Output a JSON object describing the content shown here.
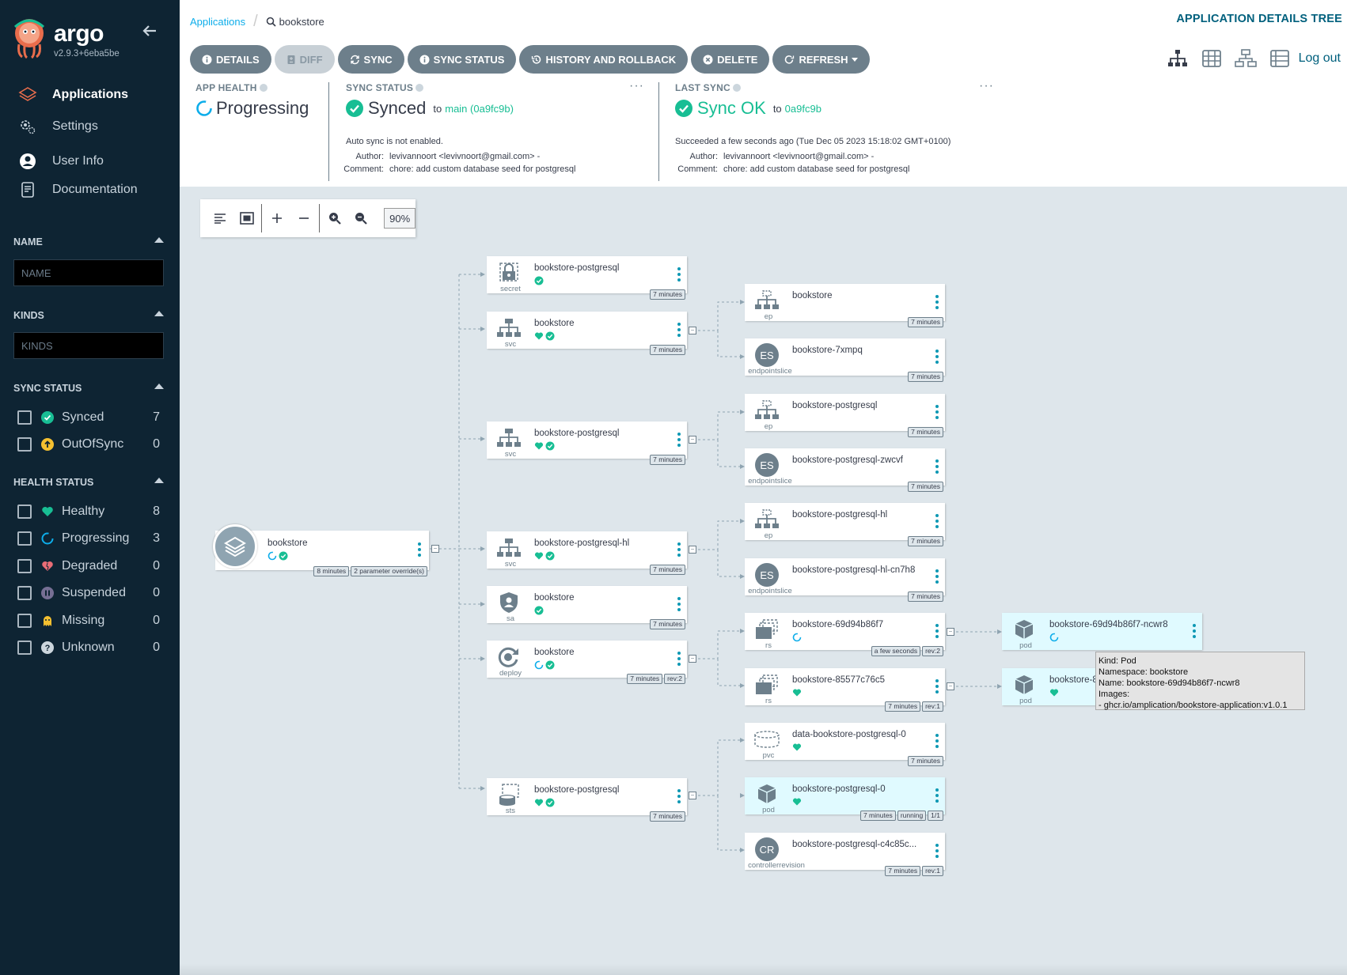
{
  "sidebar": {
    "brand": "argo",
    "version": "v2.9.3+6eba5be",
    "nav": [
      {
        "label": "Applications",
        "icon": "layers-icon"
      },
      {
        "label": "Settings",
        "icon": "gears-icon"
      },
      {
        "label": "User Info",
        "icon": "user-circle-icon"
      },
      {
        "label": "Documentation",
        "icon": "book-icon"
      }
    ],
    "filters": {
      "name_title": "NAME",
      "name_placeholder": "NAME",
      "kinds_title": "KINDS",
      "kinds_placeholder": "KINDS",
      "sync_title": "SYNC STATUS",
      "sync": [
        {
          "label": "Synced",
          "count": "7",
          "color": "#18be94"
        },
        {
          "label": "OutOfSync",
          "count": "0",
          "color": "#f4c030"
        }
      ],
      "health_title": "HEALTH STATUS",
      "health": [
        {
          "label": "Healthy",
          "count": "8",
          "color": "#18be94"
        },
        {
          "label": "Progressing",
          "count": "3",
          "color": "#0dadea"
        },
        {
          "label": "Degraded",
          "count": "0",
          "color": "#e96d76"
        },
        {
          "label": "Suspended",
          "count": "0",
          "color": "#766f94"
        },
        {
          "label": "Missing",
          "count": "0",
          "color": "#f4c030"
        },
        {
          "label": "Unknown",
          "count": "0",
          "color": "#ccd6dd"
        }
      ]
    }
  },
  "header": {
    "breadcrumb_root": "Applications",
    "breadcrumb_current": "bookstore",
    "title": "APPLICATION DETAILS TREE",
    "logout": "Log out",
    "buttons": {
      "details": "DETAILS",
      "diff": "DIFF",
      "sync": "SYNC",
      "sync_status": "SYNC STATUS",
      "history": "HISTORY AND ROLLBACK",
      "delete": "DELETE",
      "refresh": "REFRESH"
    }
  },
  "status": {
    "app_health_title": "APP HEALTH",
    "app_health": "Progressing",
    "sync_title": "SYNC STATUS",
    "sync_value": "Synced",
    "sync_to": "to",
    "sync_target": "main (0a9fc9b)",
    "auto_sync": "Auto sync is not enabled.",
    "author_label": "Author:",
    "author": "levivannoort <levivnoort@gmail.com> -",
    "comment_label": "Comment:",
    "comment": "chore: add custom database seed for postgresql",
    "last_sync_title": "LAST SYNC",
    "last_sync_value": "Sync OK",
    "last_sync_to": "to",
    "last_sync_rev": "0a9fc9b",
    "succeeded": "Succeeded a few seconds ago (Tue Dec 05 2023 15:18:02 GMT+0100)",
    "ls_author": "levivannoort <levivnoort@gmail.com> -",
    "ls_comment": "chore: add custom database seed for postgresql"
  },
  "zoom": "90%",
  "app_node": {
    "name": "bookstore",
    "tags": [
      "8 minutes",
      "2 parameter override(s)"
    ]
  },
  "nodes": {
    "n1": {
      "name": "bookstore-postgresql",
      "kind": "secret",
      "tags": [
        "7 minutes"
      ]
    },
    "n2": {
      "name": "bookstore",
      "kind": "svc",
      "tags": [
        "7 minutes"
      ]
    },
    "n3": {
      "name": "bookstore-postgresql",
      "kind": "svc",
      "tags": [
        "7 minutes"
      ]
    },
    "n4": {
      "name": "bookstore-postgresql-hl",
      "kind": "svc",
      "tags": [
        "7 minutes"
      ]
    },
    "n5": {
      "name": "bookstore",
      "kind": "sa",
      "tags": [
        "7 minutes"
      ]
    },
    "n6": {
      "name": "bookstore",
      "kind": "deploy",
      "tags": [
        "7 minutes",
        "rev:2"
      ]
    },
    "n7": {
      "name": "bookstore-postgresql",
      "kind": "sts",
      "tags": [
        "7 minutes"
      ]
    },
    "m1": {
      "name": "bookstore",
      "kind": "ep",
      "tags": [
        "7 minutes"
      ]
    },
    "m2": {
      "name": "bookstore-7xmpq",
      "kind": "endpointslice",
      "abbr": "ES",
      "tags": [
        "7 minutes"
      ]
    },
    "m3": {
      "name": "bookstore-postgresql",
      "kind": "ep",
      "tags": [
        "7 minutes"
      ]
    },
    "m4": {
      "name": "bookstore-postgresql-zwcvf",
      "kind": "endpointslice",
      "abbr": "ES",
      "tags": [
        "7 minutes"
      ]
    },
    "m5": {
      "name": "bookstore-postgresql-hl",
      "kind": "ep",
      "tags": [
        "7 minutes"
      ]
    },
    "m6": {
      "name": "bookstore-postgresql-hl-cn7h8",
      "kind": "endpointslice",
      "abbr": "ES",
      "tags": [
        "7 minutes"
      ]
    },
    "m7": {
      "name": "bookstore-69d94b86f7",
      "kind": "rs",
      "tags": [
        "a few seconds",
        "rev:2"
      ]
    },
    "m8": {
      "name": "bookstore-85577c76c5",
      "kind": "rs",
      "tags": [
        "7 minutes",
        "rev:1"
      ]
    },
    "m9": {
      "name": "data-bookstore-postgresql-0",
      "kind": "pvc",
      "tags": [
        "7 minutes"
      ]
    },
    "m10": {
      "name": "bookstore-postgresql-0",
      "kind": "pod",
      "tags": [
        "7 minutes",
        "running",
        "1/1"
      ]
    },
    "m11": {
      "name": "bookstore-postgresql-c4c85c...",
      "kind": "controllerrevision",
      "abbr": "CR",
      "tags": [
        "7 minutes",
        "rev:1"
      ]
    },
    "p1": {
      "name": "bookstore-69d94b86f7-ncwr8",
      "kind": "pod",
      "tags": []
    },
    "p2": {
      "name": "bookstore-8",
      "kind": "pod",
      "tags": []
    }
  },
  "tooltip": {
    "l1": "Kind: Pod",
    "l2": "Namespace: bookstore",
    "l3": "Name: bookstore-69d94b86f7-ncwr8",
    "l4": "Images:",
    "l5": "- ghcr.io/amplication/bookstore-application:v1.0.1"
  }
}
